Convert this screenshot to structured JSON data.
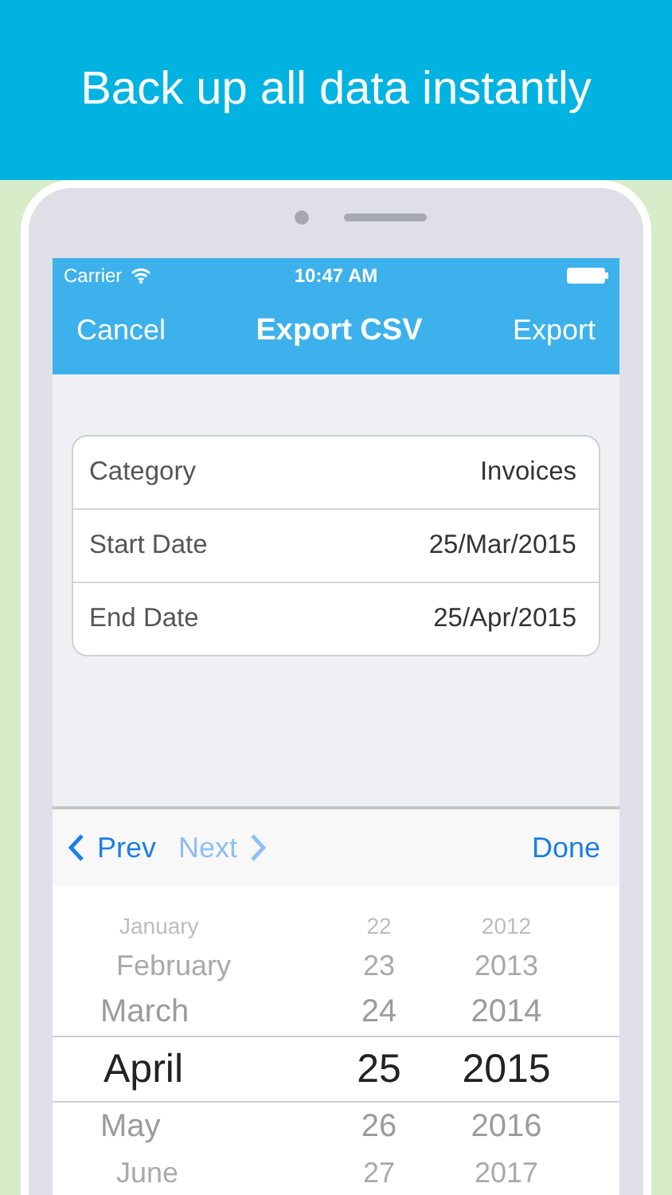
{
  "banner": {
    "headline": "Back up all data instantly"
  },
  "status_bar": {
    "carrier": "Carrier",
    "time": "10:47 AM"
  },
  "nav": {
    "left": "Cancel",
    "title": "Export CSV",
    "right": "Export"
  },
  "form": [
    {
      "label": "Category",
      "value": "Invoices"
    },
    {
      "label": "Start Date",
      "value": "25/Mar/2015"
    },
    {
      "label": "End Date",
      "value": "25/Apr/2015"
    }
  ],
  "toolbar": {
    "prev": {
      "label": "Prev",
      "disabled": false
    },
    "next": {
      "label": "Next",
      "disabled": true
    },
    "done": "Done"
  },
  "picker": {
    "rows": [
      {
        "month": "January",
        "day": "22",
        "year": "2012",
        "selected": false
      },
      {
        "month": "February",
        "day": "23",
        "year": "2013",
        "selected": false
      },
      {
        "month": "March",
        "day": "24",
        "year": "2014",
        "selected": false
      },
      {
        "month": "April",
        "day": "25",
        "year": "2015",
        "selected": true
      },
      {
        "month": "May",
        "day": "26",
        "year": "2016",
        "selected": false
      },
      {
        "month": "June",
        "day": "27",
        "year": "2017",
        "selected": false
      }
    ]
  }
}
